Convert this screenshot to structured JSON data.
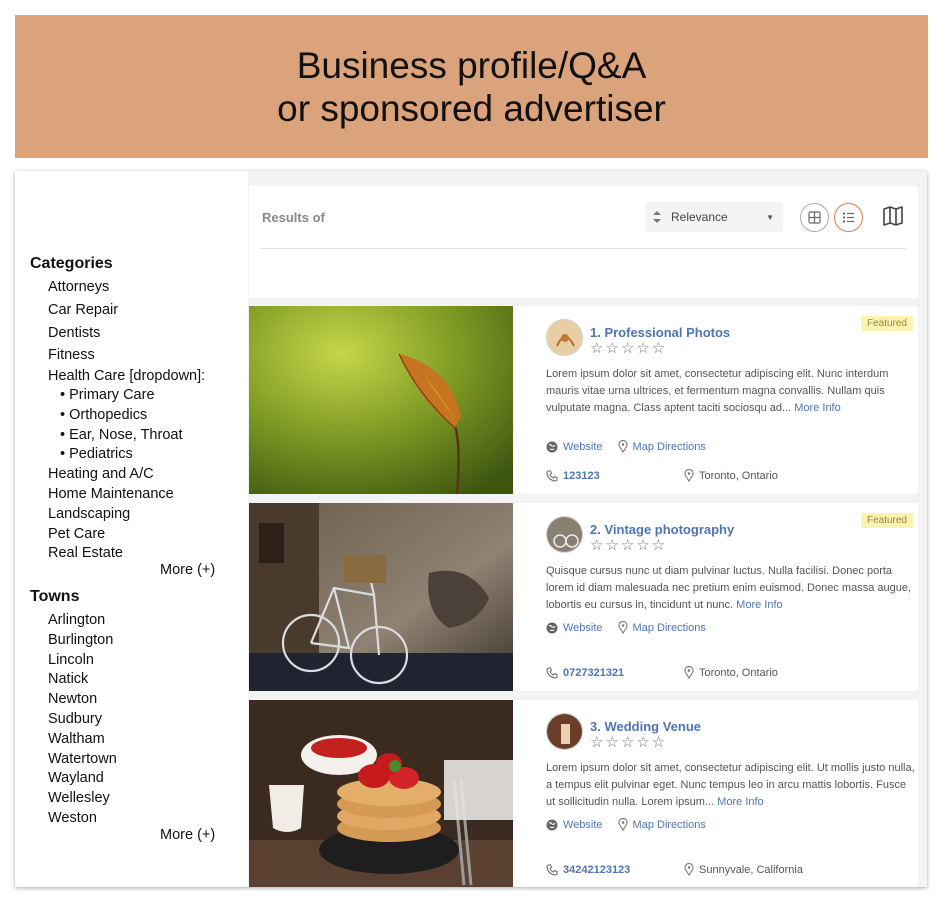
{
  "banner": {
    "line1": "Business profile/Q&A",
    "line2": "or sponsored advertiser"
  },
  "sidebar": {
    "categories_heading": "Categories",
    "categories": [
      "Attorneys",
      "Car Repair",
      "Dentists",
      "Fitness",
      "Health Care [dropdown]:"
    ],
    "health_care_subitems": [
      "• Primary Care",
      "• Orthopedics",
      "• Ear, Nose, Throat",
      "• Pediatrics"
    ],
    "categories_more": [
      "Heating and A/C",
      "Home Maintenance",
      "Landscaping",
      "Pet Care",
      "Real Estate"
    ],
    "categories_more_link": "More (+)",
    "towns_heading": "Towns",
    "towns": [
      "Arlington",
      "Burlington",
      "Lincoln",
      "Natick",
      "Newton",
      "Sudbury",
      "Waltham",
      "Watertown",
      "Wayland",
      "Wellesley",
      "Weston"
    ],
    "towns_more_link": "More (+)"
  },
  "topbar": {
    "results_label": "Results of",
    "sort_value": "Relevance",
    "icons": {
      "sort": "sort-arrows-icon",
      "grid": "grid-view-icon",
      "list": "list-view-icon",
      "map": "map-icon"
    },
    "active_view_color": "#e07b4b"
  },
  "listings": [
    {
      "title": "1. Professional Photos",
      "badge": "Featured",
      "rating_stars": "☆☆☆☆☆",
      "description": "Lorem ipsum dolor sit amet, consectetur adipiscing elit. Nunc interdum mauris vitae urna ultrices, et fermentum magna convallis. Nullam quis vulputate magna. Class aptent taciti sociosqu ad...",
      "more_info": "More Info",
      "website_label": "Website",
      "directions_label": "Map Directions",
      "phone": "123123",
      "location": "Toronto, Ontario"
    },
    {
      "title": "2. Vintage photography",
      "badge": "Featured",
      "rating_stars": "☆☆☆☆☆",
      "description": "Quisque cursus nunc ut diam pulvinar luctus. Nulla facilisi. Donec porta lorem id diam malesuada nec pretium enim euismod. Donec massa augue, lobortis eu cursus in, tincidunt ut nunc.",
      "more_info": "More Info",
      "website_label": "Website",
      "directions_label": "Map Directions",
      "phone": "0727321321",
      "location": "Toronto, Ontario"
    },
    {
      "title": "3. Wedding Venue",
      "badge": "",
      "rating_stars": "☆☆☆☆☆",
      "description": "Lorem ipsum dolor sit amet, consectetur adipiscing elit. Ut mollis justo nulla, a tempus elit pulvinar eget. Nunc tempus leo in arcu mattis lobortis. Fusce ut sollicitudin nulla. Lorem ipsum...",
      "more_info": "More Info",
      "website_label": "Website",
      "directions_label": "Map Directions",
      "phone": "34242123123",
      "location": "Sunnyvale, California"
    }
  ],
  "colors": {
    "banner_bg": "#dba37b",
    "link": "#4f74b3",
    "featured_bg": "#fbf2b4"
  }
}
